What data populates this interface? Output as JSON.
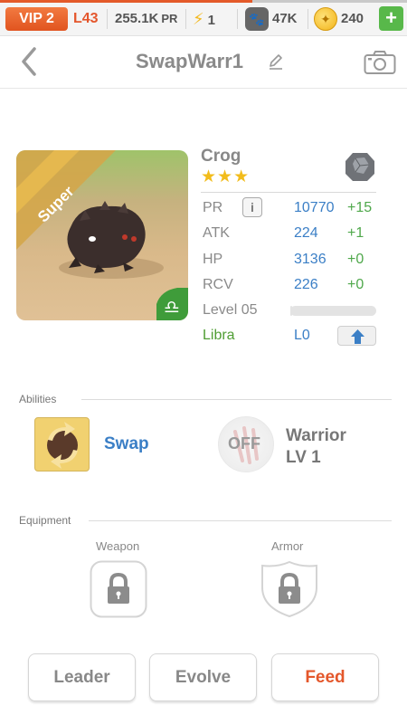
{
  "status_bar": {
    "vip": "VIP 2",
    "level": "L43",
    "power_value": "255.1K",
    "power_unit": "PR",
    "energy": "1",
    "paw_count": "47K",
    "coins": "240",
    "add_label": "+"
  },
  "header": {
    "title": "SwapWarr1"
  },
  "monster": {
    "rank": "Super",
    "name": "Crog",
    "stars": "★★★",
    "stats": [
      {
        "label": "PR",
        "value": "10770",
        "delta": "+15"
      },
      {
        "label": "ATK",
        "value": "224",
        "delta": "+1"
      },
      {
        "label": "HP",
        "value": "3136",
        "delta": "+0"
      },
      {
        "label": "RCV",
        "value": "226",
        "delta": "+0"
      }
    ],
    "info_label": "i",
    "level_label": "Level 05",
    "level_progress": 0.0,
    "sign": "Libra",
    "sign_level": "L0"
  },
  "abilities": {
    "section_label": "Abilities",
    "active": "Swap",
    "passive_state": "OFF",
    "passive_name": "Warrior",
    "passive_level": "LV 1"
  },
  "equipment": {
    "section_label": "Equipment",
    "weapon_label": "Weapon",
    "armor_label": "Armor"
  },
  "actions": {
    "leader": "Leader",
    "evolve": "Evolve",
    "feed": "Feed"
  },
  "colors": {
    "accent_orange": "#e4572b",
    "stat_blue": "#3b7fc6",
    "delta_green": "#4fa84b",
    "libra_green": "#4f9d33",
    "plus_green": "#58b84a"
  }
}
